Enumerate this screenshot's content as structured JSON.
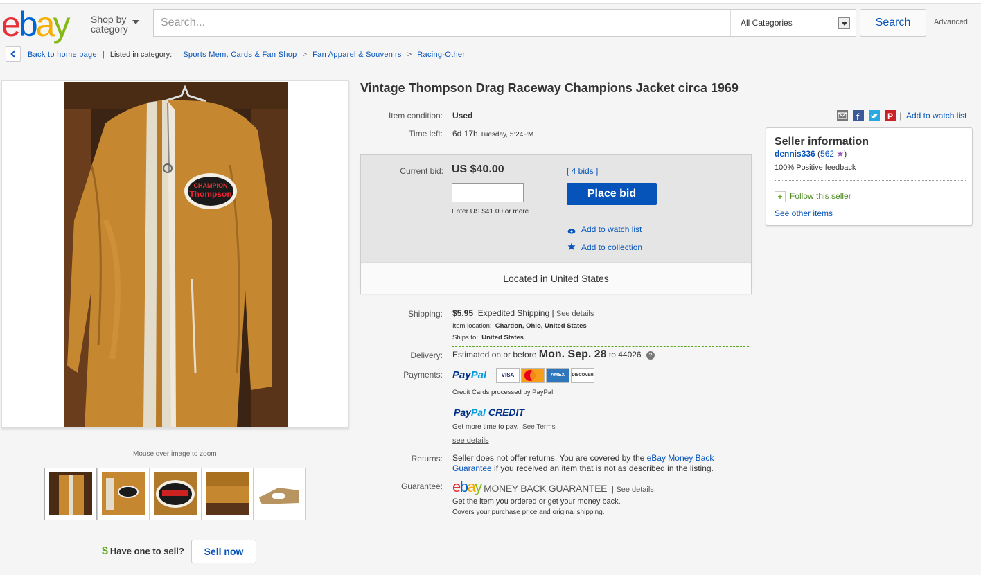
{
  "header": {
    "logo": "ebay",
    "shop_by_line1": "Shop by",
    "shop_by_line2": "category",
    "search_placeholder": "Search...",
    "category": "All Categories",
    "search_button": "Search",
    "advanced": "Advanced"
  },
  "breadcrumb": {
    "back": "Back to home page",
    "listed_in": "Listed in category:",
    "path": [
      "Sports Mem, Cards & Fan Shop",
      "Fan Apparel & Souvenirs",
      "Racing-Other"
    ],
    "separator": ">"
  },
  "gallery": {
    "zoom_hint": "Mouse over image to zoom",
    "thumbnail_count": 5
  },
  "sell": {
    "prompt": "Have one to sell?",
    "button": "Sell now"
  },
  "item": {
    "title": "Vintage Thompson Drag Raceway Champions Jacket circa 1969",
    "condition_label": "Item condition:",
    "condition": "Used",
    "time_left_label": "Time left:",
    "time_left": "6d 17h",
    "time_left_detail": "Tuesday, 5:24PM",
    "current_bid_label": "Current bid:",
    "current_bid": "US $40.00",
    "bids": "4 bids",
    "bid_hint": "Enter US $41.00 or more",
    "place_bid": "Place bid",
    "add_watch": "Add to watch list",
    "add_collection": "Add to collection",
    "location": "Located in United States"
  },
  "shipping": {
    "label": "Shipping:",
    "cost": "$5.95",
    "method": "Expedited Shipping",
    "see_details": "See details",
    "item_location_label": "Item location:",
    "item_location": "Chardon, Ohio, United States",
    "ships_to_label": "Ships to:",
    "ships_to": "United States"
  },
  "delivery": {
    "label": "Delivery:",
    "prefix": "Estimated on or before",
    "date": "Mon. Sep. 28",
    "to": "to 44026"
  },
  "payments": {
    "label": "Payments:",
    "paypal_a": "Pay",
    "paypal_b": "Pal",
    "cards": [
      "VISA",
      "MC",
      "AMEX",
      "DISCOVER"
    ],
    "processed": "Credit Cards processed by PayPal",
    "credit_word": "CREDIT",
    "more_time": "Get more time to pay.",
    "see_terms": "See Terms",
    "see_details": "see details"
  },
  "returns": {
    "label": "Returns:",
    "text_a": "Seller does not offer returns. You are covered by the ",
    "link": "eBay Money Back Guarantee",
    "text_b": " if you received an item that is not as described in the listing."
  },
  "guarantee": {
    "label": "Guarantee:",
    "logo_text": "MONEY BACK GUARANTEE",
    "see_details": "See details",
    "line1": "Get the item you ordered or get your money back.",
    "line2": "Covers your purchase price and original shipping."
  },
  "share": {
    "add_watch": "Add to watch list"
  },
  "seller": {
    "heading": "Seller information",
    "name": "dennis336",
    "score": "562",
    "feedback": "100% Positive feedback",
    "follow": "Follow this seller",
    "see_other": "See other items"
  },
  "colors": {
    "ebay_blue": "#0654ba",
    "green": "#5ba71b",
    "jacket": "#c98a2e"
  }
}
